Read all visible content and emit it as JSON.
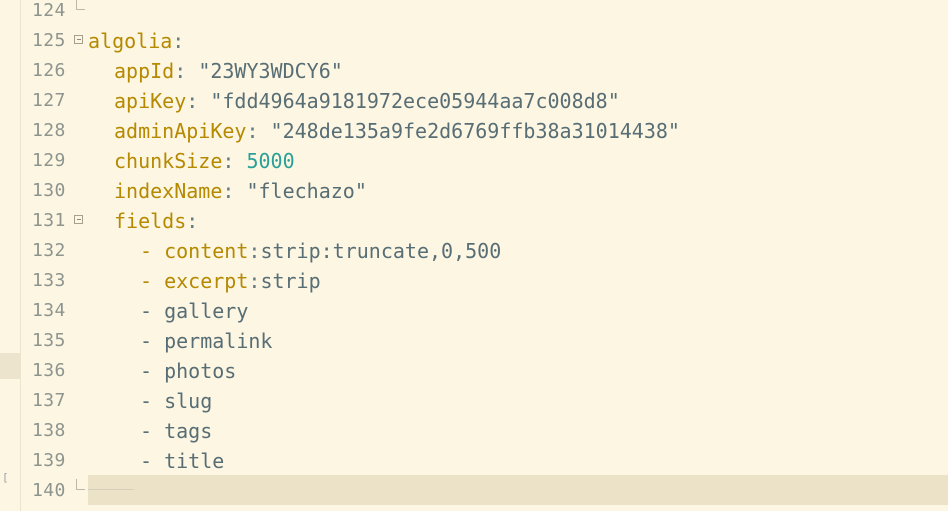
{
  "editor": {
    "lines": [
      {
        "number": "124",
        "content": ""
      },
      {
        "number": "125",
        "key": "algolia",
        "sep": ":"
      },
      {
        "number": "126",
        "key": "appId",
        "sep": ": ",
        "value": "\"23WY3WDCY6\""
      },
      {
        "number": "127",
        "key": "apiKey",
        "sep": ": ",
        "value": "\"fdd4964a9181972ece05944aa7c008d8\""
      },
      {
        "number": "128",
        "key": "adminApiKey",
        "sep": ": ",
        "value": "\"248de135a9fe2d6769ffb38a31014438\""
      },
      {
        "number": "129",
        "key": "chunkSize",
        "sep": ": ",
        "value": "5000"
      },
      {
        "number": "130",
        "key": "indexName",
        "sep": ": ",
        "value": "\"flechazo\""
      },
      {
        "number": "131",
        "key": "fields",
        "sep": ":"
      },
      {
        "number": "132",
        "dash": "- ",
        "key": "content",
        "sep": ":",
        "value": "strip:truncate,0,500"
      },
      {
        "number": "133",
        "dash": "- ",
        "key": "excerpt",
        "sep": ":",
        "value": "strip"
      },
      {
        "number": "134",
        "dash": "- ",
        "value": "gallery"
      },
      {
        "number": "135",
        "dash": "- ",
        "value": "permalink"
      },
      {
        "number": "136",
        "dash": "- ",
        "value": "photos"
      },
      {
        "number": "137",
        "dash": "- ",
        "value": "slug"
      },
      {
        "number": "138",
        "dash": "- ",
        "value": "tags"
      },
      {
        "number": "139",
        "dash": "- ",
        "value": "title"
      },
      {
        "number": "140",
        "content": ""
      }
    ]
  },
  "colors": {
    "background": "#fdf6e3",
    "key": "#b58900",
    "string": "#586e75",
    "number": "#2aa198",
    "line_number": "#8d958e",
    "current_line": "#ebe2c8"
  },
  "left_strip": {
    "marker_symbol": "["
  },
  "icons": {
    "fold_open_125": "fold-collapse-icon",
    "fold_open_131": "fold-collapse-icon",
    "fold_end_124": "fold-end-icon",
    "fold_end_140": "fold-end-icon"
  }
}
